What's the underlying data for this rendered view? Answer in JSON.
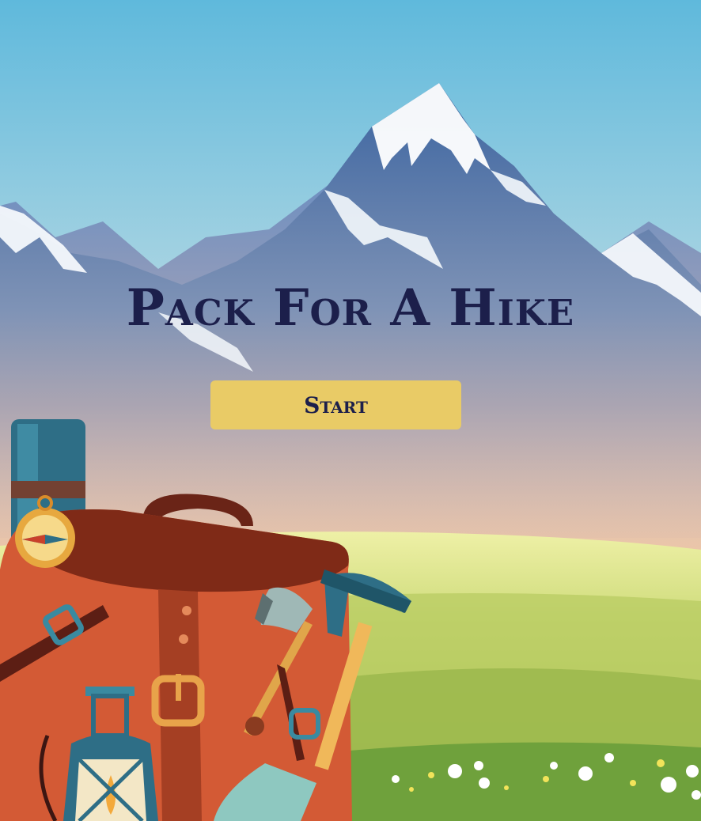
{
  "game": {
    "title": "Pack For A Hike",
    "start_label": "Start"
  },
  "colors": {
    "title": "#1c1f4b",
    "button_bg": "#e9cb66",
    "sky_top": "#5fb9dc",
    "meadow": "#a8c65a",
    "backpack": "#d35a35"
  },
  "icons": [
    "mountain-icon",
    "backpack-icon",
    "compass-icon",
    "axe-icon",
    "shovel-icon",
    "lantern-icon",
    "sleeping-mat-icon",
    "flower-icon"
  ]
}
